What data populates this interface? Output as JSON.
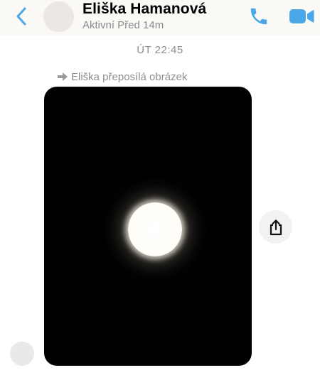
{
  "header": {
    "contact_name": "Eliška Hamanová",
    "status": "Aktivní Před 14m"
  },
  "conversation": {
    "timestamp": "ÚT 22:45",
    "forward_label": "Eliška přeposílá obrázek"
  },
  "icons": {
    "back": "chevron-left-icon",
    "call": "phone-icon",
    "video_call": "video-camera-icon",
    "forward": "forward-arrow-icon",
    "share": "share-icon"
  },
  "colors": {
    "accent": "#4aa8e8",
    "header_bg": "#fbf9f6",
    "secondary_text": "#8e8e93",
    "photo_bg": "#000000"
  }
}
